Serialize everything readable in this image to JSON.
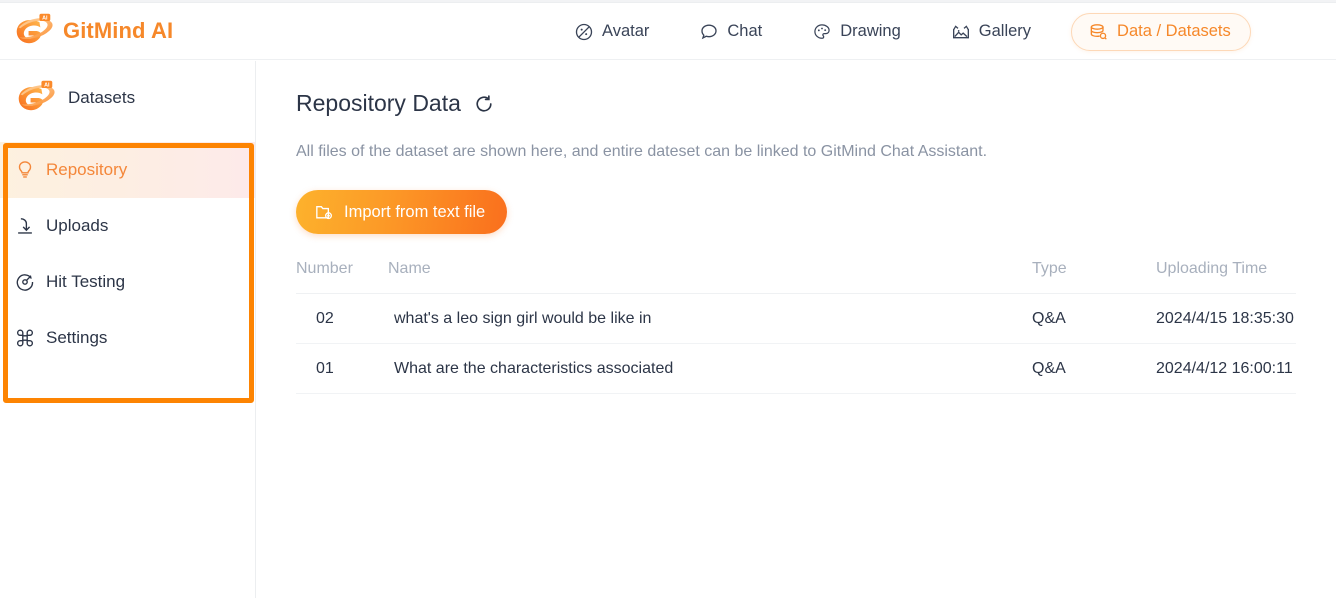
{
  "brand": {
    "name": "GitMind AI",
    "logo_icon": "gitmind-logo-icon"
  },
  "nav": {
    "items": [
      {
        "label": "Avatar",
        "icon": "avatar-icon"
      },
      {
        "label": "Chat",
        "icon": "chat-bubble-icon"
      },
      {
        "label": "Drawing",
        "icon": "palette-icon"
      },
      {
        "label": "Gallery",
        "icon": "gallery-image-icon"
      }
    ],
    "active_pill": {
      "label": "Data /  Datasets",
      "icon": "database-stack-icon"
    }
  },
  "sidebar": {
    "title": "Datasets",
    "logo_icon": "gitmind-logo-icon",
    "items": [
      {
        "label": "Repository",
        "icon": "lightbulb-icon",
        "active": true
      },
      {
        "label": "Uploads",
        "icon": "upload-arrow-icon",
        "active": false
      },
      {
        "label": "Hit Testing",
        "icon": "target-icon",
        "active": false
      },
      {
        "label": "Settings",
        "icon": "flower-grid-icon",
        "active": false
      }
    ]
  },
  "main": {
    "title": "Repository Data",
    "refresh_icon": "refresh-icon",
    "description": "All files of the dataset are shown here, and entire dateset can be linked to GitMind Chat Assistant.",
    "import_button": {
      "label": "Import from text file",
      "icon": "folder-plus-icon"
    },
    "table": {
      "headers": [
        "Number",
        "Name",
        "Type",
        "Uploading Time"
      ],
      "rows": [
        {
          "number": "02",
          "name": "what's a leo sign girl would be like in",
          "type": "Q&A",
          "time": "2024/4/15 18:35:30"
        },
        {
          "number": "01",
          "name": "What are the characteristics associated",
          "type": "Q&A",
          "time": "2024/4/12 16:00:11"
        }
      ]
    }
  },
  "annotation": {
    "color": "#fd8402",
    "target": "sidebar-menu"
  },
  "colors": {
    "brand_orange": "#f6882a",
    "annotation_orange": "#fd8402",
    "text_dark": "#2c3547",
    "text_muted": "#8a93a3",
    "header_muted": "#a8b0bd"
  }
}
